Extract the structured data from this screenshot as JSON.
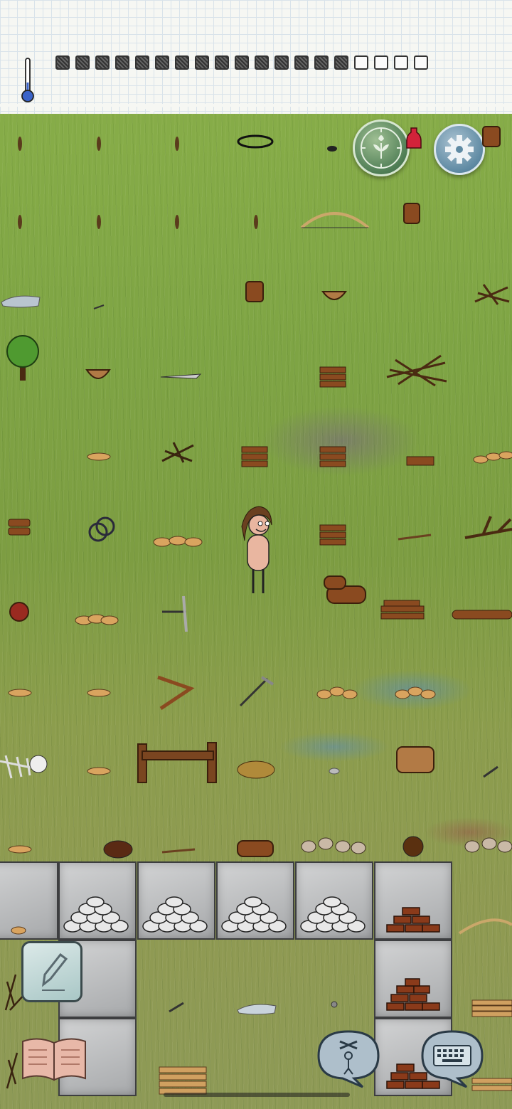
{
  "hud": {
    "thermometer_icon": "thermometer-icon",
    "food_pips_total": 19,
    "food_pips_filled": 15
  },
  "buttons": {
    "compass_icon": "compass-flower-icon",
    "settings_icon": "gear-icon",
    "edit_icon": "pencil-icon",
    "journal_icon": "open-book-icon",
    "emote_icon": "puppet-emote-icon",
    "keyboard_icon": "keyboard-icon"
  },
  "colors": {
    "grass": "#7ea444",
    "stone": "#b8babc",
    "hud_paper": "#f6f7f3"
  }
}
